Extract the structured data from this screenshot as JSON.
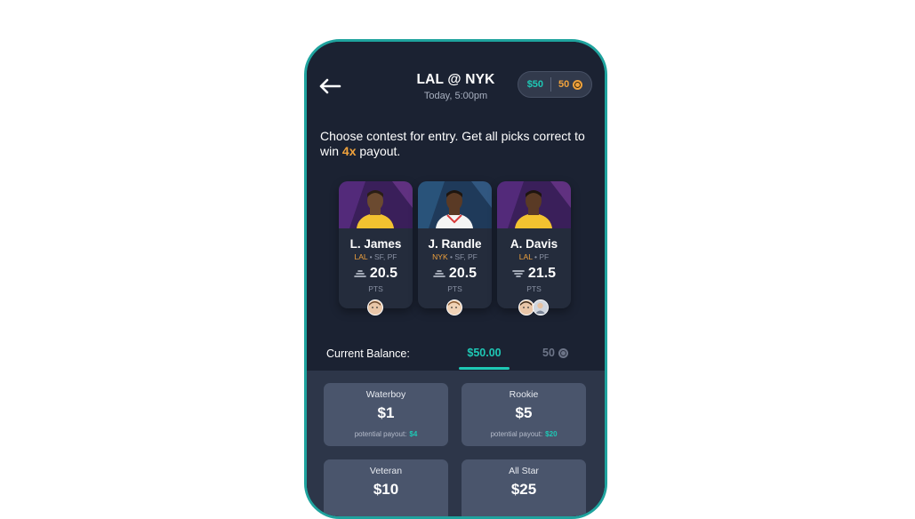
{
  "header": {
    "title": "LAL @ NYK",
    "subtitle": "Today, 5:00pm",
    "back_icon": "arrow-left-icon",
    "balance_cash": "$50",
    "balance_coins": "50"
  },
  "instructions": {
    "before": "Choose contest for entry. Get all picks correct to win ",
    "highlight": "4x",
    "after": " payout."
  },
  "players": [
    {
      "name": "L. James",
      "team": "LAL",
      "positions": "SF, PF",
      "projection": "20.5",
      "stat": "PTS",
      "pick_icon": "more-than-icon"
    },
    {
      "name": "J. Randle",
      "team": "NYK",
      "positions": "SF, PF",
      "projection": "20.5",
      "stat": "PTS",
      "pick_icon": "more-than-icon"
    },
    {
      "name": "A. Davis",
      "team": "LAL",
      "positions": "PF",
      "projection": "21.5",
      "stat": "PTS",
      "pick_icon": "less-than-icon"
    }
  ],
  "balance": {
    "label": "Current Balance:",
    "cash_tab": "$50.00",
    "coins_tab": "50"
  },
  "contests": [
    {
      "name": "Waterboy",
      "price": "$1",
      "payout_label": "potential payout:",
      "payout": "$4"
    },
    {
      "name": "Rookie",
      "price": "$5",
      "payout_label": "potential payout:",
      "payout": "$20"
    },
    {
      "name": "Veteran",
      "price": "$10",
      "payout_label": "",
      "payout": ""
    },
    {
      "name": "All Star",
      "price": "$25",
      "payout_label": "",
      "payout": ""
    }
  ],
  "colors": {
    "accent": "#1ec8b5",
    "orange": "#f0a23c",
    "phone_border": "#1fa39e",
    "background": "#1b2232"
  }
}
